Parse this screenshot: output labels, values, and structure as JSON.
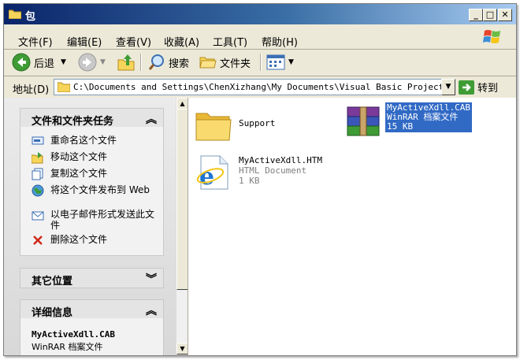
{
  "window": {
    "title": "包"
  },
  "menu": [
    "文件(F)",
    "编辑(E)",
    "查看(V)",
    "收藏(A)",
    "工具(T)",
    "帮助(H)"
  ],
  "toolbar": {
    "back": "后退",
    "search": "搜索",
    "folders": "文件夹"
  },
  "address": {
    "label": "地址(D)",
    "path": "C:\\Documents and Settings\\ChenXizhang\\My Documents\\Visual Basic Projects\\",
    "go": "转到"
  },
  "tasks_panel": {
    "title": "文件和文件夹任务",
    "items": [
      "重命名这个文件",
      "移动这个文件",
      "复制这个文件",
      "将这个文件发布到 Web",
      "以电子邮件形式发送此文件",
      "删除这个文件"
    ]
  },
  "other_panel": {
    "title": "其它位置"
  },
  "details_panel": {
    "title": "详细信息",
    "name": "MyActiveXdll.CAB",
    "type": "WinRAR 档案文件"
  },
  "files": [
    {
      "name": "Support",
      "icon": "folder-icon"
    },
    {
      "name": "MyActiveXdll.CAB",
      "type": "WinRAR 档案文件",
      "size": "15 KB",
      "icon": "winrar-archive-icon",
      "selected": true
    },
    {
      "name": "MyActiveXdll.HTM",
      "type": "HTML Document",
      "size": "1 KB",
      "icon": "ie-html-icon"
    }
  ],
  "colors": {
    "selection": "#316ac5",
    "title_bar": "#0a246a"
  }
}
